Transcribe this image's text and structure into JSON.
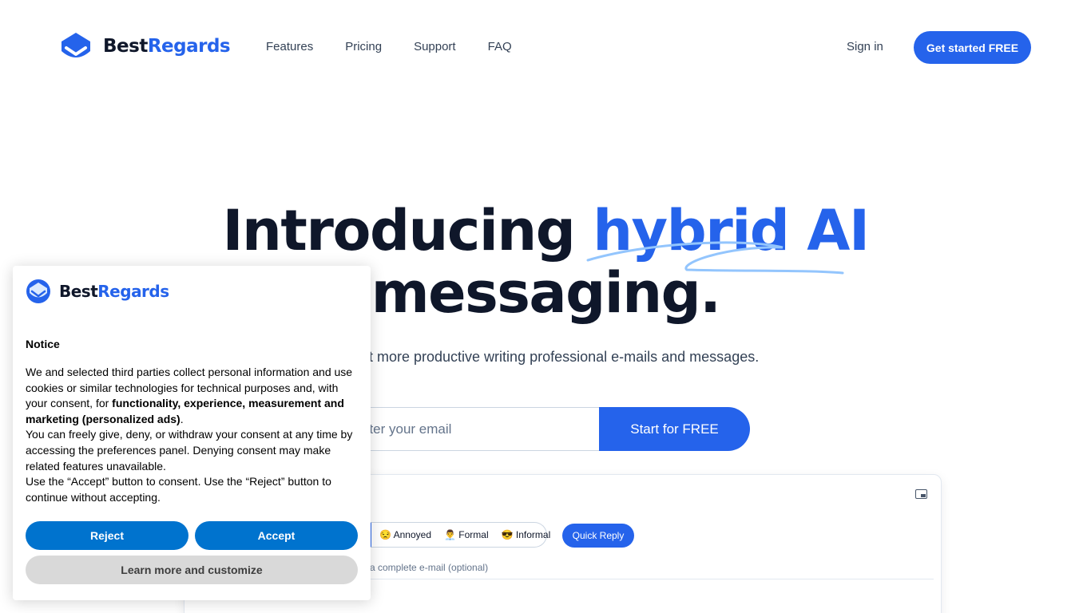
{
  "brand": {
    "name_part1": "Best",
    "name_part2": "Regards",
    "logo_icon": "bestregards-logo-icon",
    "accent_color": "#2563eb"
  },
  "nav": {
    "items": [
      {
        "label": "Features"
      },
      {
        "label": "Pricing"
      },
      {
        "label": "Support"
      },
      {
        "label": "FAQ"
      }
    ]
  },
  "header": {
    "signin_label": "Sign in",
    "cta_label": "Get started FREE"
  },
  "hero": {
    "title_part1": "Introducing ",
    "title_accent": "hybrid AI",
    "title_part2": "messaging.",
    "subtitle": "t more productive writing professional e-mails and messages.",
    "email_placeholder": "nter your email",
    "start_label": "Start for FREE"
  },
  "demo": {
    "tones": [
      {
        "label": "😒 Annoyed"
      },
      {
        "label": "👨‍💼 Formal"
      },
      {
        "label": "😎 Informal"
      }
    ],
    "quick_reply_label": "Quick Reply",
    "hint": "a complete e-mail (optional)",
    "window_icon": "picture-in-picture-icon"
  },
  "cookie": {
    "title": "Notice",
    "para1_start": "We and selected third parties collect personal information and use cookies or similar technologies for technical purposes and, with your consent, for ",
    "para1_bold": "functionality, experience, measurement and marketing (personalized ads)",
    "para1_end": ".",
    "para2": "You can freely give, deny, or withdraw your consent at any time by accessing the preferences panel. Denying consent may make related features unavailable.",
    "para3": "Use the “Accept” button to consent. Use the “Reject” button to continue without accepting.",
    "reject_label": "Reject",
    "accept_label": "Accept",
    "learn_label": "Learn more and customize",
    "button_color": "#0073ce"
  }
}
